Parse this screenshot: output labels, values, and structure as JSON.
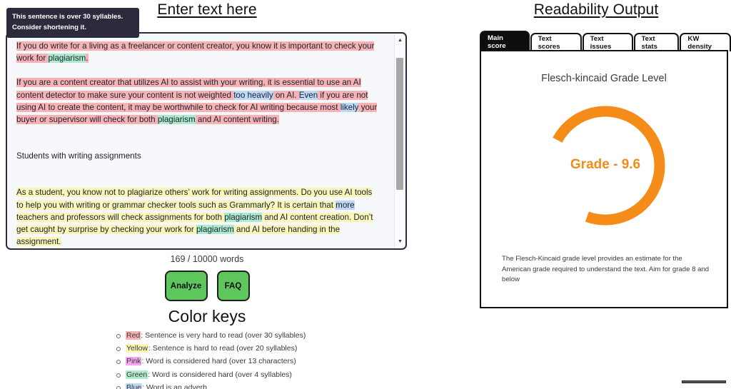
{
  "left": {
    "heading": "Enter text here",
    "tooltip": "This sentence is over 30 syllables. Consider shortening it.",
    "editor": {
      "paragraphs": [
        {
          "id": "p1",
          "runs": [
            {
              "text": "If you do write for a living as a freelancer or content creator, you know it is important to check your work for ",
              "hl": "red"
            },
            {
              "text": "plagiarism",
              "hl": "green"
            },
            {
              "text": ".",
              "hl": "red"
            }
          ]
        },
        {
          "id": "p2",
          "runs": [
            {
              "text": "If you are a content creator that utilizes AI to assist with your writing, it is essential to use an AI content detector to make sure your content is not weighted ",
              "hl": "red"
            },
            {
              "text": "too heavily",
              "hl": "blue"
            },
            {
              "text": " on AI. ",
              "hl": "red"
            },
            {
              "text": "Even",
              "hl": "blue"
            },
            {
              "text": " if you are not using AI to create the content, it may be worthwhile to check for AI writing because most ",
              "hl": "red"
            },
            {
              "text": "likely",
              "hl": "blue"
            },
            {
              "text": " your buyer or supervisor will check for both ",
              "hl": "red"
            },
            {
              "text": "plagiarism",
              "hl": "green"
            },
            {
              "text": " and AI content writing.",
              "hl": "red"
            }
          ]
        },
        {
          "id": "p3",
          "runs": [
            {
              "text": "Students with writing assignments",
              "hl": "none"
            }
          ]
        },
        {
          "id": "p4",
          "runs": [
            {
              "text": "As a student, you know not to plagiarize others’ work for writing assignments. Do you use AI tools to help you with writing or grammar checker tools such as Grammarly? It is certain that ",
              "hl": "yellow"
            },
            {
              "text": "more",
              "hl": "blue"
            },
            {
              "text": " teachers and professors will check assignments for both ",
              "hl": "yellow"
            },
            {
              "text": "plagiarism",
              "hl": "green"
            },
            {
              "text": " and AI content creation. Don’t get caught by surprise by checking your work for ",
              "hl": "yellow"
            },
            {
              "text": "plagiarism",
              "hl": "green"
            },
            {
              "text": " and AI before handing in the assignment.",
              "hl": "yellow"
            }
          ]
        }
      ]
    },
    "scrollbar": {
      "up_icon": "▲",
      "down_icon": "▼"
    },
    "word_count": "169 / 10000 words",
    "analyze_label": "Analyze",
    "faq_label": "FAQ",
    "color_keys_heading": "Color keys",
    "color_keys": [
      {
        "name": "Red",
        "color": "#f7b3b3",
        "desc": ": Sentence is very hard to read (over 30 syllables)"
      },
      {
        "name": "Yellow",
        "color": "#faf6b8",
        "desc": ": Sentence is hard to read (over 20 syllables)"
      },
      {
        "name": "Pink",
        "color": "#f2a9ec",
        "desc": ": Word is considered hard (over 13 characters)"
      },
      {
        "name": "Green",
        "color": "#aeeacd",
        "desc": ": Word is considered hard (over 4 syllables)"
      },
      {
        "name": "Blue",
        "color": "#bfd8f3",
        "desc": ": Word is an adverb"
      }
    ]
  },
  "right": {
    "heading": "Readability Output",
    "tabs": [
      {
        "label": "Main score",
        "active": true
      },
      {
        "label": "Text scores",
        "active": false
      },
      {
        "label": "Text issues",
        "active": false
      },
      {
        "label": "Text stats",
        "active": false
      },
      {
        "label": "KW density",
        "active": false
      }
    ],
    "gauge_title": "Flesch-kincaid Grade Level",
    "gauge_value": "Grade - 9.6",
    "gauge_color": "#f58b18",
    "gauge_description": "The Flesch-Kincaid grade level provides an estimate for the American grade required to understand the text. Aim for grade 8 and below"
  },
  "chart_data": {
    "type": "pie",
    "title": "Flesch-kincaid Grade Level",
    "categories": [
      "Flesch-Kincaid Grade Level"
    ],
    "values": [
      9.6
    ],
    "value_label": "Grade - 9.6",
    "scale_max": 13.2,
    "arc_fraction": 0.727,
    "arc_start_deg": -62,
    "arc_end_deg": 200,
    "color": "#f58b18",
    "legend": "none",
    "grid": false
  }
}
